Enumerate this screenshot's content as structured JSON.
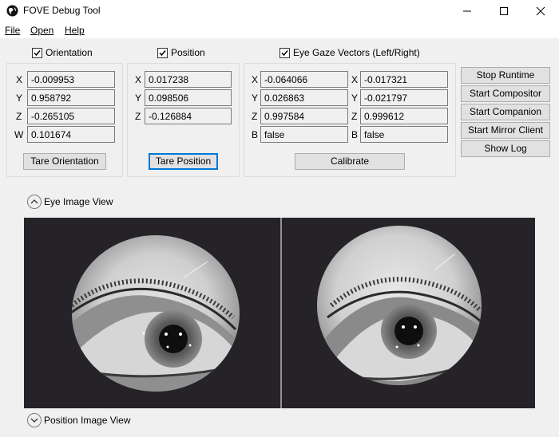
{
  "window": {
    "title": "FOVE Debug Tool"
  },
  "menu": {
    "file": "File",
    "open": "Open",
    "help": "Help"
  },
  "checks": {
    "orientation": "Orientation",
    "position": "Position",
    "gaze": "Eye Gaze Vectors (Left/Right)"
  },
  "orientation": {
    "labels": {
      "x": "X",
      "y": "Y",
      "z": "Z",
      "w": "W"
    },
    "x": "-0.009953",
    "y": "0.958792",
    "z": "-0.265105",
    "w": "0.101674",
    "tare_label": "Tare Orientation"
  },
  "position": {
    "labels": {
      "x": "X",
      "y": "Y",
      "z": "Z"
    },
    "x": "0.017238",
    "y": "0.098506",
    "z": "-0.126884",
    "tare_label": "Tare Position"
  },
  "gaze": {
    "left": {
      "labels": {
        "x": "X",
        "y": "Y",
        "z": "Z",
        "b": "B"
      },
      "x": "-0.064066",
      "y": "0.026863",
      "z": "0.997584",
      "b": "false"
    },
    "right": {
      "labels": {
        "x": "X",
        "y": "Y",
        "z": "Z",
        "b": "B"
      },
      "x": "-0.017321",
      "y": "-0.021797",
      "z": "0.999612",
      "b": "false"
    },
    "calibrate_label": "Calibrate"
  },
  "side_buttons": {
    "stop_runtime": "Stop Runtime",
    "start_compositor": "Start Compositor",
    "start_companion": "Start Companion",
    "start_mirror": "Start Mirror Client",
    "show_log": "Show Log"
  },
  "sections": {
    "eye_image": "Eye Image View",
    "position_image": "Position Image View"
  },
  "icons": {
    "app": "globe-icon",
    "minimize": "minimize-icon",
    "maximize": "maximize-icon",
    "close": "close-icon",
    "check": "checkmark-icon",
    "chevron": "chevron-icon"
  }
}
